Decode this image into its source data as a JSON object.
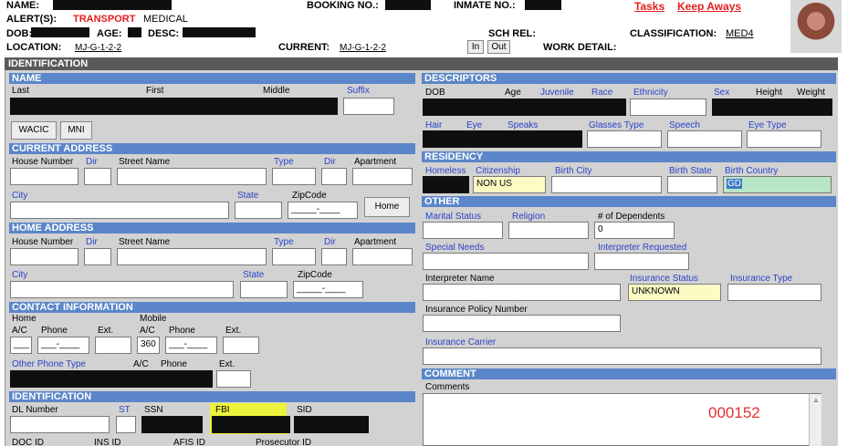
{
  "header": {
    "name_label": "NAME:",
    "booking_label": "BOOKING NO.:",
    "inmate_label": "INMATE NO.:",
    "tasks_link": "Tasks",
    "keepaways_link": "Keep Aways",
    "alerts_label": "ALERT(S):",
    "alert_transport": "TRANSPORT",
    "alert_medical": "MEDICAL",
    "dob_label": "DOB:",
    "age_label": "AGE:",
    "desc_label": "DESC:",
    "schrel_label": "SCH REL:",
    "classification_label": "CLASSIFICATION:",
    "classification_value": "MED4",
    "location_label": "LOCATION:",
    "location_value": "MJ-G-1-2-2",
    "current_label": "CURRENT:",
    "current_value": "MJ-G-1-2-2",
    "in_btn": "In",
    "out_btn": "Out",
    "work_label": "WORK DETAIL:"
  },
  "identification_title": "IDENTIFICATION",
  "name_section": {
    "title": "NAME",
    "last": "Last",
    "first": "First",
    "middle": "Middle",
    "suffix": "Suffix",
    "wacic_btn": "WACIC",
    "mni_btn": "MNI"
  },
  "current_address": {
    "title": "CURRENT ADDRESS",
    "house": "House Number",
    "dir": "Dir",
    "street": "Street Name",
    "type": "Type",
    "dir2": "Dir",
    "apartment": "Apartment",
    "city": "City",
    "state": "State",
    "zip": "ZipCode",
    "zip_value": "_____-____",
    "home_btn": "Home"
  },
  "home_address": {
    "title": "HOME ADDRESS",
    "house": "House Number",
    "dir": "Dir",
    "street": "Street Name",
    "type": "Type",
    "dir2": "Dir",
    "apartment": "Apartment",
    "city": "City",
    "state": "State",
    "zip": "ZipCode",
    "zip_value": "_____-____"
  },
  "contact": {
    "title": "CONTACT INFORMATION",
    "home": "Home",
    "mobile": "Mobile",
    "ac": "A/C",
    "phone": "Phone",
    "ext": "Ext.",
    "ac2": "A/C",
    "phone2": "Phone",
    "ext2": "Ext.",
    "home_ac": "___",
    "home_phone": "___-____",
    "mobile_ac": "360",
    "mobile_phone": "___-____",
    "other_type": "Other Phone Type",
    "ac3": "A/C",
    "phone3": "Phone",
    "ext3": "Ext."
  },
  "identification": {
    "title": "IDENTIFICATION",
    "dl": "DL Number",
    "st": "ST",
    "ssn": "SSN",
    "fbi": "FBI",
    "sid": "SID",
    "doc": "DOC ID",
    "ins": "INS ID",
    "afis": "AFIS ID",
    "prosecutor": "Prosecutor ID"
  },
  "descriptors": {
    "title": "DESCRIPTORS",
    "dob": "DOB",
    "age": "Age",
    "juvenile": "Juvenile",
    "race": "Race",
    "ethnicity": "Ethnicity",
    "sex": "Sex",
    "height": "Height",
    "weight": "Weight",
    "hair": "Hair",
    "eye": "Eye",
    "speaks": "Speaks",
    "glasses": "Glasses Type",
    "speech": "Speech",
    "eye_type": "Eye Type"
  },
  "residency": {
    "title": "RESIDENCY",
    "homeless": "Homeless",
    "citizenship": "Citizenship",
    "birth_city": "Birth City",
    "birth_state": "Birth State",
    "birth_country": "Birth Country",
    "citizenship_value": "NON US",
    "birth_country_value": "GD"
  },
  "other": {
    "title": "OTHER",
    "marital": "Marital Status",
    "religion": "Religion",
    "dependents": "# of Dependents",
    "dependents_value": "0",
    "special_needs": "Special Needs",
    "interpreter_req": "Interpreter Requested",
    "interpreter_name": "Interpreter Name",
    "insurance_status": "Insurance Status",
    "insurance_status_value": "UNKNOWN",
    "insurance_type": "Insurance Type",
    "policy": "Insurance Policy Number",
    "carrier": "Insurance Carrier"
  },
  "comment": {
    "title": "COMMENT",
    "label": "Comments",
    "stamp": "000152"
  },
  "colors": {
    "section_blue": "#5b86c9",
    "label_blue": "#2a43c9",
    "alert_red": "#e31d1d",
    "highlight_yellow": "#ecf33a",
    "stamp_red": "#e03030"
  }
}
